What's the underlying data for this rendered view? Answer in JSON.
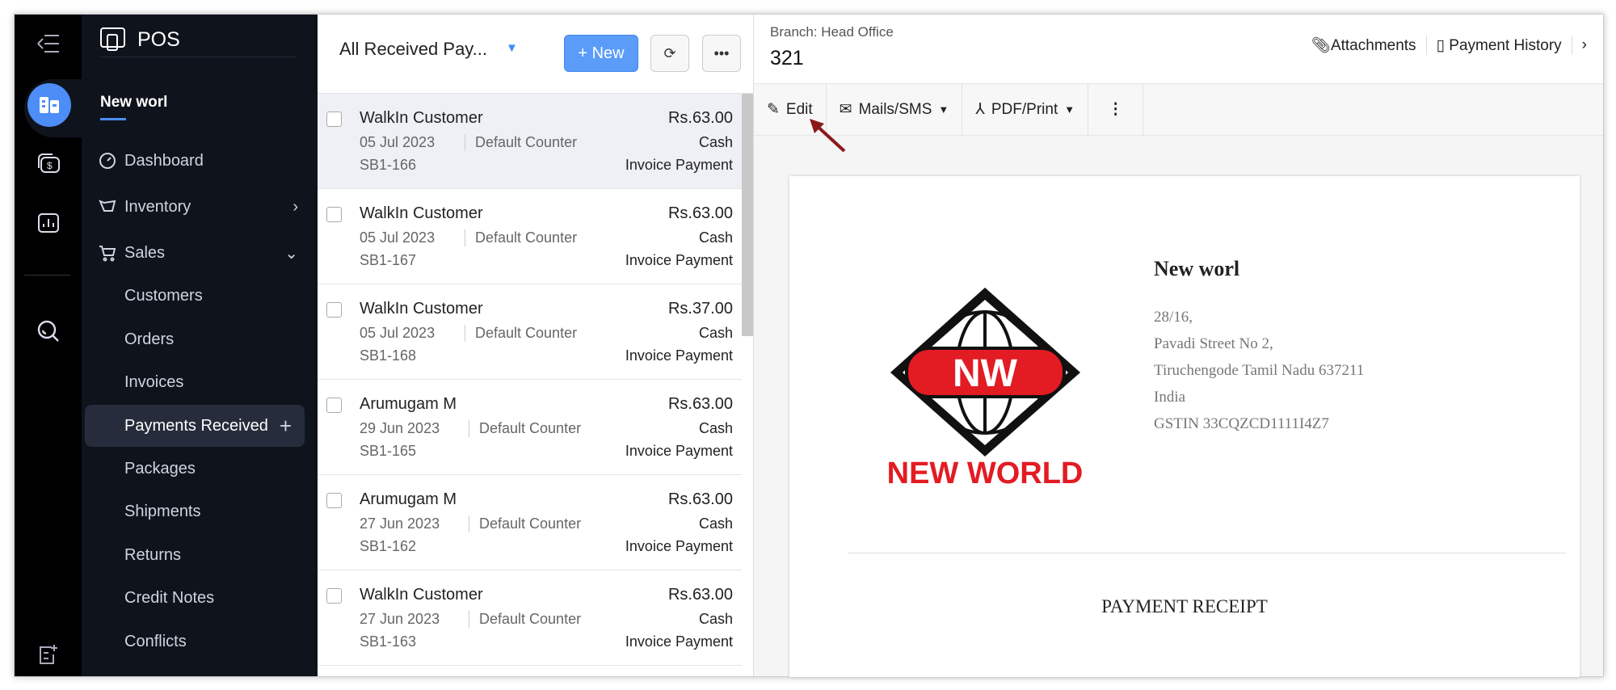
{
  "app": {
    "name": "POS",
    "org": "New worl"
  },
  "sidebar": {
    "items": [
      {
        "label": "Dashboard",
        "icon": "dashboard-icon"
      },
      {
        "label": "Inventory",
        "icon": "inventory-icon"
      },
      {
        "label": "Sales",
        "icon": "cart-icon"
      },
      {
        "label": "Customers"
      },
      {
        "label": "Orders"
      },
      {
        "label": "Invoices"
      },
      {
        "label": "Payments Received",
        "active": true
      },
      {
        "label": "Packages"
      },
      {
        "label": "Shipments"
      },
      {
        "label": "Returns"
      },
      {
        "label": "Credit Notes"
      },
      {
        "label": "Conflicts"
      }
    ]
  },
  "list": {
    "title": "All Received Pay...",
    "new_label": "+ New",
    "rows": [
      {
        "name": "WalkIn Customer",
        "date": "05 Jul 2023",
        "counter": "Default Counter",
        "number": "SB1-166",
        "amount": "Rs.63.00",
        "mode": "Cash",
        "type": "Invoice Payment"
      },
      {
        "name": "WalkIn Customer",
        "date": "05 Jul 2023",
        "counter": "Default Counter",
        "number": "SB1-167",
        "amount": "Rs.63.00",
        "mode": "Cash",
        "type": "Invoice Payment"
      },
      {
        "name": "WalkIn Customer",
        "date": "05 Jul 2023",
        "counter": "Default Counter",
        "number": "SB1-168",
        "amount": "Rs.37.00",
        "mode": "Cash",
        "type": "Invoice Payment"
      },
      {
        "name": "Arumugam M",
        "date": "29 Jun 2023",
        "counter": "Default Counter",
        "number": "SB1-165",
        "amount": "Rs.63.00",
        "mode": "Cash",
        "type": "Invoice Payment"
      },
      {
        "name": "Arumugam M",
        "date": "27 Jun 2023",
        "counter": "Default Counter",
        "number": "SB1-162",
        "amount": "Rs.63.00",
        "mode": "Cash",
        "type": "Invoice Payment"
      },
      {
        "name": "WalkIn Customer",
        "date": "27 Jun 2023",
        "counter": "Default Counter",
        "number": "SB1-163",
        "amount": "Rs.63.00",
        "mode": "Cash",
        "type": "Invoice Payment"
      }
    ]
  },
  "detail": {
    "branch": "Branch: Head Office",
    "number": "321",
    "attachments": "Attachments",
    "payment_history": "Payment History",
    "toolbar": {
      "edit": "Edit",
      "mails": "Mails/SMS",
      "pdf": "PDF/Print"
    },
    "receipt": {
      "company": "New worl",
      "address": [
        "28/16,",
        "Pavadi Street No 2,",
        "Tiruchengode Tamil Nadu 637211",
        "India",
        "GSTIN 33CQZCD1111I4Z7"
      ],
      "title": "PAYMENT RECEIPT",
      "logo_text": "NW",
      "logo_caption": "NEW WORLD"
    }
  },
  "colors": {
    "accent": "#408dfb",
    "logo_red": "#e31b23"
  }
}
